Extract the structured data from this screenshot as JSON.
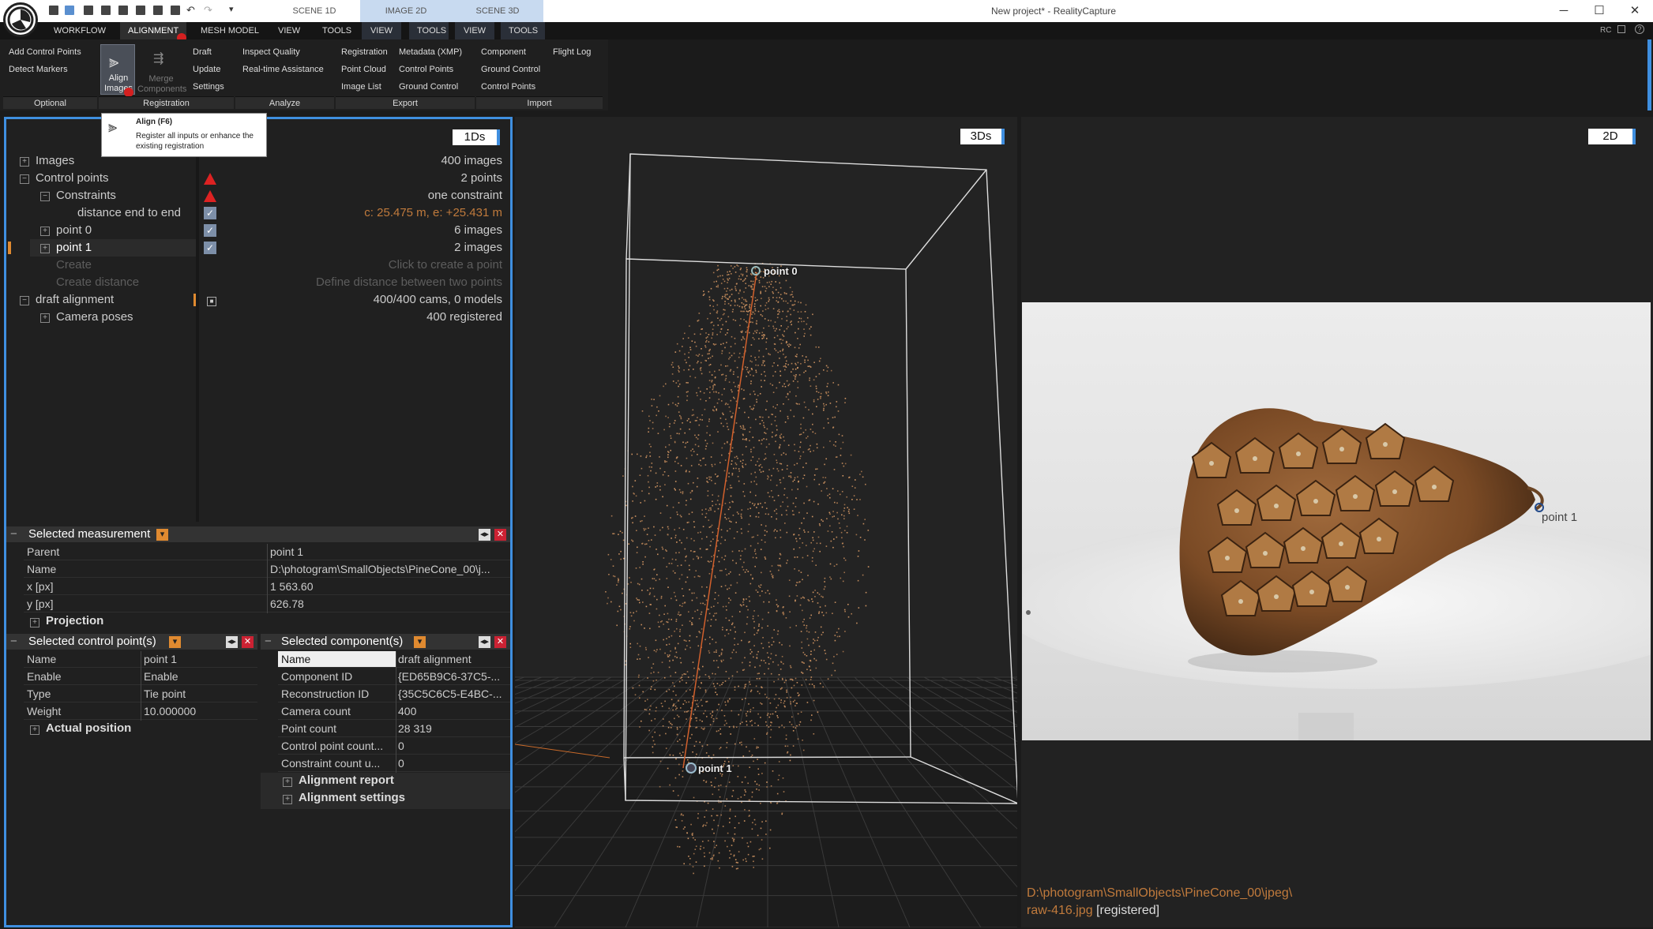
{
  "titlebar": {
    "view_tabs": [
      "SCENE 1D",
      "IMAGE 2D",
      "SCENE 3D"
    ],
    "window_title": "New project* - RealityCapture",
    "minimize": "─",
    "maximize": "☐",
    "close": "✕"
  },
  "menubar": {
    "left": [
      "WORKFLOW",
      "ALIGNMENT",
      "MESH MODEL",
      "VIEW",
      "TOOLS"
    ],
    "tab_groups": [
      "VIEW",
      "TOOLS",
      "VIEW",
      "TOOLS"
    ],
    "right": [
      "RC"
    ]
  },
  "ribbon": {
    "optional": {
      "label": "Optional",
      "items": [
        "Add Control Points",
        "Detect Markers"
      ]
    },
    "registration": {
      "label": "Registration",
      "align": "Align Images",
      "merge": "Merge Components",
      "items": [
        "Draft",
        "Update",
        "Settings"
      ]
    },
    "analyze": {
      "label": "Analyze",
      "items": [
        "Inspect Quality",
        "Real-time Assistance"
      ]
    },
    "export": {
      "label": "Export",
      "items": [
        "Registration",
        "Point Cloud",
        "Image List",
        "Metadata (XMP)",
        "Control Points",
        "Ground Control"
      ]
    },
    "import": {
      "label": "Import",
      "items": [
        "Component",
        "Ground Control",
        "Control Points",
        "Flight Log"
      ]
    }
  },
  "tooltip": {
    "title": "Align (F6)",
    "body": "Register all inputs or enhance the existing registration"
  },
  "scene1d": {
    "badge": "1Ds",
    "tree": [
      {
        "label": "Images",
        "value": "400 images"
      },
      {
        "label": "Control points",
        "value": "2 points"
      },
      {
        "label": "Constraints",
        "value": "one constraint"
      },
      {
        "label": "distance end to end",
        "value": "c: 25.475 m, e: +25.431 m"
      },
      {
        "label": "point 0",
        "value": "6 images"
      },
      {
        "label": "point 1",
        "value": "2 images"
      },
      {
        "label": "Create",
        "value": "Click to create a point"
      },
      {
        "label": "Create distance",
        "value": "Define distance between two points"
      },
      {
        "label": "draft alignment",
        "value": "400/400 cams, 0 models"
      },
      {
        "label": "Camera poses",
        "value": "400 registered"
      }
    ]
  },
  "measurement": {
    "title": "Selected measurement",
    "rows": [
      {
        "k": "Parent",
        "v": "point 1"
      },
      {
        "k": "Name",
        "v": "D:\\photogram\\SmallObjects\\PineCone_00\\j..."
      },
      {
        "k": "x [px]",
        "v": "1 563.60"
      },
      {
        "k": "y [px]",
        "v": "626.78"
      }
    ],
    "section": "Projection"
  },
  "control_points": {
    "title": "Selected control point(s)",
    "rows": [
      {
        "k": "Name",
        "v": "point 1"
      },
      {
        "k": "Enable",
        "v": "Enable"
      },
      {
        "k": "Type",
        "v": "Tie point"
      },
      {
        "k": "Weight",
        "v": "10.000000"
      }
    ],
    "section": "Actual position"
  },
  "components": {
    "title": "Selected component(s)",
    "rows": [
      {
        "k": "Name",
        "v": "draft alignment"
      },
      {
        "k": "Component ID",
        "v": "{ED65B9C6-37C5-..."
      },
      {
        "k": "Reconstruction ID",
        "v": "{35C5C6C5-E4BC-..."
      },
      {
        "k": "Camera count",
        "v": "400"
      },
      {
        "k": "Point count",
        "v": "28 319"
      },
      {
        "k": "Control point count...",
        "v": "0"
      },
      {
        "k": "Constraint count u...",
        "v": "0"
      }
    ],
    "sections": [
      "Alignment report",
      "Alignment settings"
    ]
  },
  "scene3d": {
    "badge": "3Ds",
    "point0": "point 0",
    "point1": "point 1"
  },
  "image2d": {
    "badge": "2D",
    "point1": "point 1",
    "path": "D:\\photogram\\SmallObjects\\PineCone_00\\jpeg\\",
    "file": "raw-416.jpg",
    "status": "[registered]"
  },
  "colors": {
    "accent": "#3f8fe0",
    "orange": "#c07a3c",
    "alert": "#d42020"
  }
}
